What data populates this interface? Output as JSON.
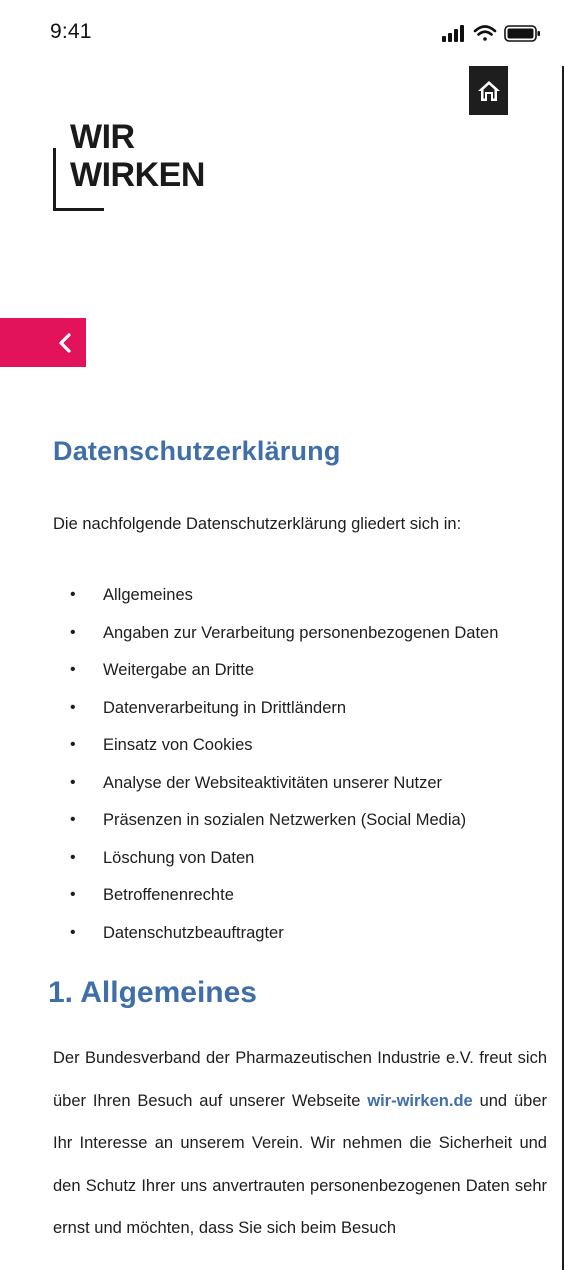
{
  "status_bar": {
    "time": "9:41",
    "icons": [
      "cellular-signal-icon",
      "wifi-icon",
      "battery-icon"
    ]
  },
  "header": {
    "logo_line1": "WIR",
    "logo_line2": "WIRKEN",
    "home_icon": "home-icon"
  },
  "nav": {
    "back_icon": "chevron-left-icon",
    "accent_color": "#e2135b"
  },
  "page": {
    "title": "Datenschutzerklärung",
    "intro": "Die nachfolgende Datenschutzerklärung gliedert sich in:",
    "toc": [
      "Allgemeines",
      "Angaben zur Verarbeitung personenbezogenen Daten",
      "Weitergabe an Dritte",
      "Datenverarbeitung in Drittländern",
      "Einsatz von Cookies",
      "Analyse der Websiteaktivitäten unserer Nutzer",
      "Präsenzen in sozialen Netzwerken (Social Media)",
      "Löschung von Daten",
      "Betroffenenrechte",
      "Datenschutzbeauftragter"
    ],
    "section1": {
      "heading": "1. Allgemeines",
      "text_before_link": "Der Bundesverband der Pharmazeutischen Industrie e.V. freut sich über Ihren Besuch auf unserer Webseite ",
      "link_text": "wir-wirken.de",
      "text_after_link": " und über Ihr Interesse an unserem Verein. Wir nehmen die Sicherheit und den Schutz Ihrer uns anvertrauten personenbezogenen Daten sehr ernst und möchten, dass Sie sich beim Besuch"
    },
    "heading_color": "#3f6ea8"
  }
}
